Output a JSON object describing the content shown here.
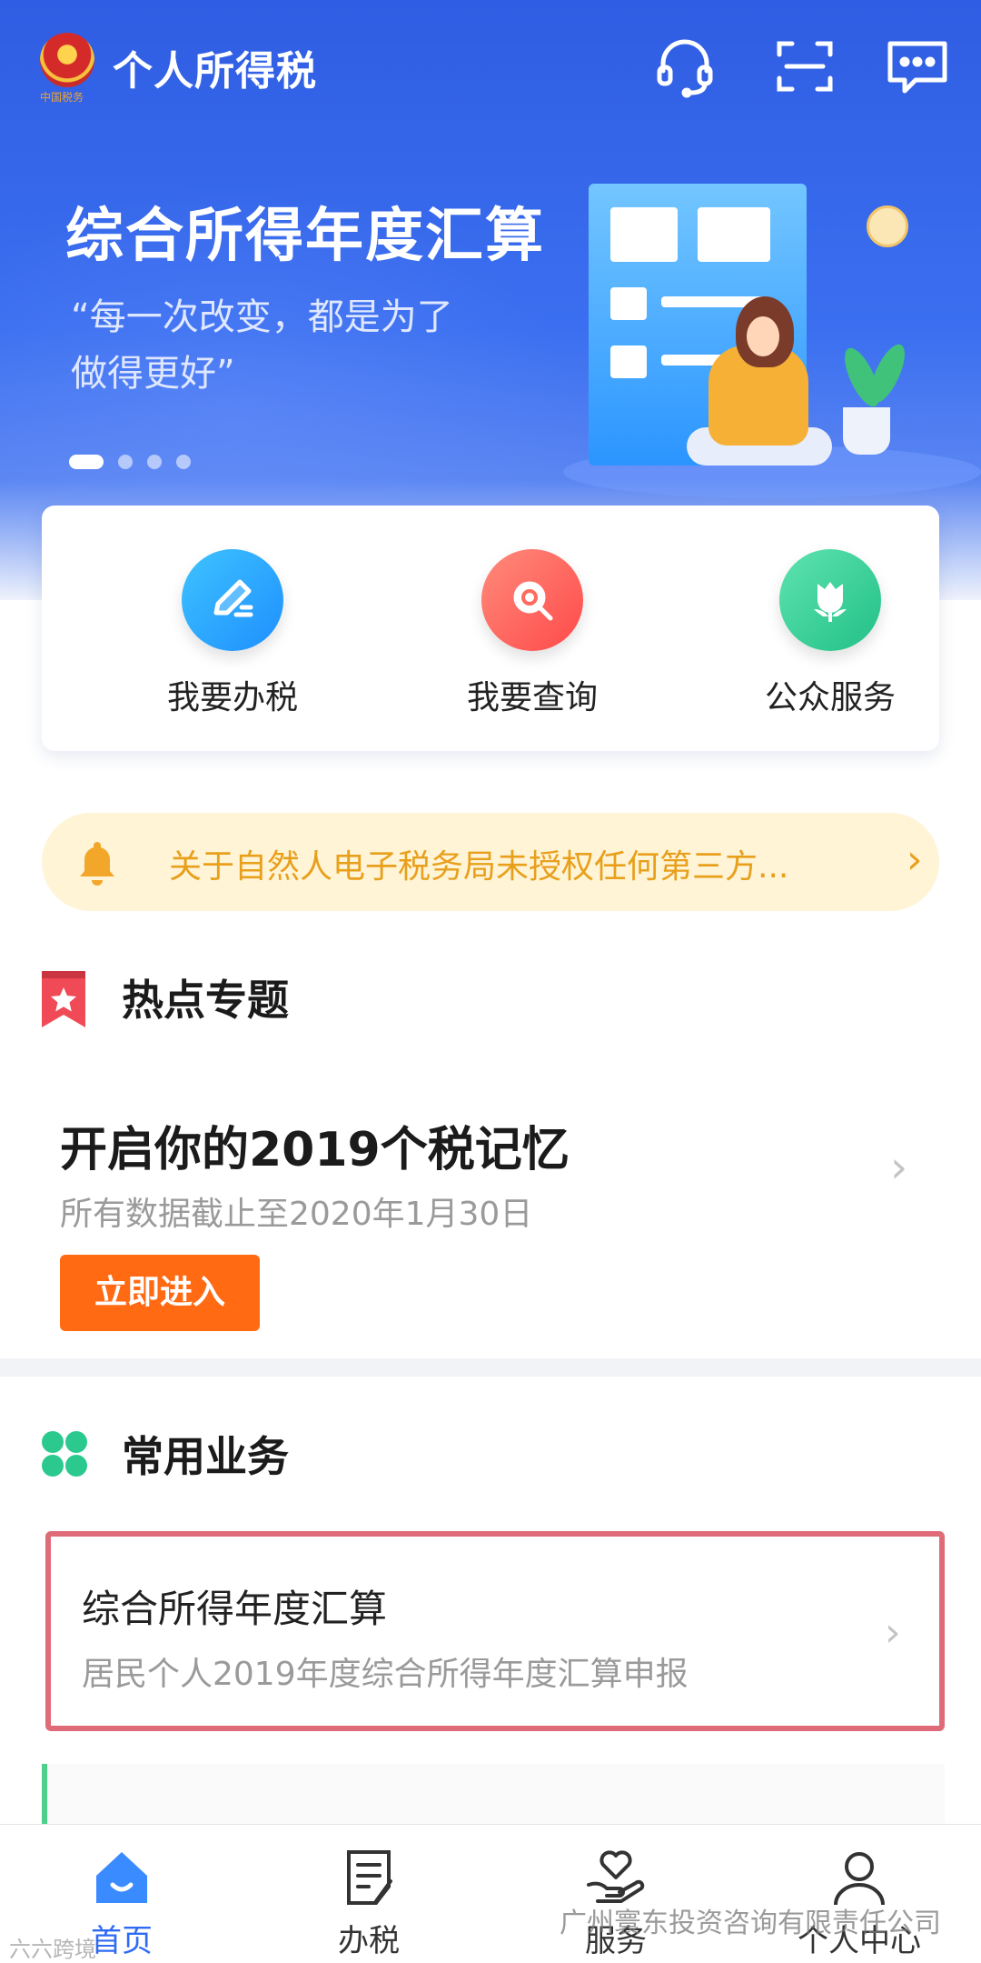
{
  "header": {
    "app_title": "个人所得税",
    "emblem_caption": "中国税务",
    "icons": [
      "headset-icon",
      "scan-icon",
      "chat-icon"
    ]
  },
  "banner": {
    "title": "综合所得年度汇算",
    "quote": "“每一次改变，都是为了做得更好”",
    "slide_count": 4,
    "active_slide": 1
  },
  "quick_actions": [
    {
      "label": "我要办税",
      "icon": "edit-icon",
      "color": "#1e8fff"
    },
    {
      "label": "我要查询",
      "icon": "search-icon",
      "color": "#ff4a4a"
    },
    {
      "label": "公众服务",
      "icon": "tulip-icon",
      "color": "#22c087"
    }
  ],
  "notice": {
    "text": "关于自然人电子税务局未授权任何第三方...",
    "color": "#e8a01c"
  },
  "hot_topics": {
    "section_title": "热点专题",
    "topic_title": "开启你的2019个税记忆",
    "topic_subtitle": "所有数据截止至2020年1月30日",
    "button_label": "立即进入",
    "button_color": "#ff6a13"
  },
  "common_business": {
    "section_title": "常用业务",
    "items": [
      {
        "title": "综合所得年度汇算",
        "subtitle": "居民个人2019年度综合所得年度汇算申报"
      }
    ]
  },
  "tabbar": {
    "tabs": [
      {
        "label": "首页",
        "icon": "home-icon",
        "active": true
      },
      {
        "label": "办税",
        "icon": "document-icon",
        "active": false
      },
      {
        "label": "服务",
        "icon": "heart-hand-icon",
        "active": false
      },
      {
        "label": "个人中心",
        "icon": "person-icon",
        "active": false
      }
    ],
    "active_color": "#2f6bf2"
  },
  "watermarks": {
    "right": "广州寰东投资咨询有限责任公司",
    "left": "六六跨境"
  }
}
